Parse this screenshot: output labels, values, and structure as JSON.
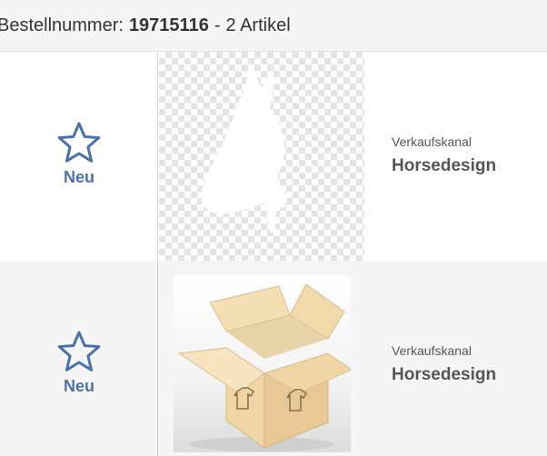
{
  "order": {
    "label": "Bestellnummer:",
    "number": "19715116",
    "separator": "-",
    "count": "2 Artikel"
  },
  "items": [
    {
      "status": "Neu",
      "status_icon": "star-outline-icon",
      "thumbnail": "horse-head-silhouette-transparent",
      "toggle_icon": "contrast-toggle-icon",
      "channel_label": "Verkaufskanal",
      "channel_name": "Horsedesign"
    },
    {
      "status": "Neu",
      "status_icon": "star-outline-icon",
      "thumbnail": "cardboard-box-with-shirt-icons",
      "channel_label": "Verkaufskanal",
      "channel_name": "Horsedesign"
    }
  ],
  "colors": {
    "accent": "#4a72a8",
    "header_bg": "#f5f5f5",
    "row_alt_bg": "#f5f5f5",
    "text": "#333333"
  }
}
